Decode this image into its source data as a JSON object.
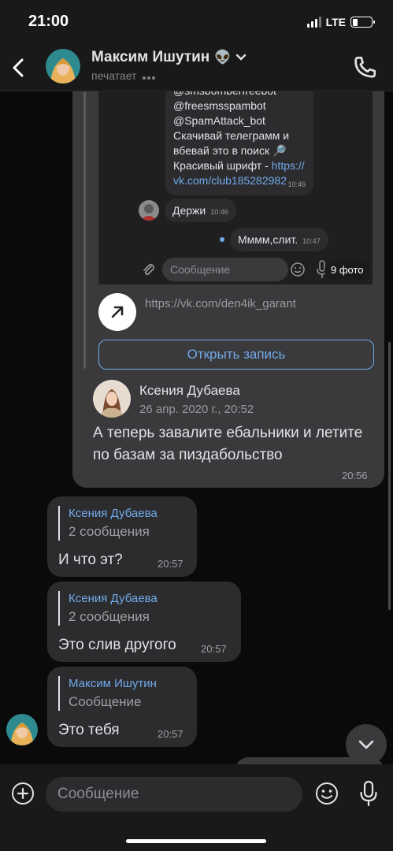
{
  "status_bar": {
    "time": "21:00",
    "network": "LTE",
    "battery_level": 0.3
  },
  "header": {
    "contact_name": "Максим Ишутин",
    "name_emoji": "👽",
    "status": "печатает",
    "icons": [
      "back-icon",
      "chevron-down-icon",
      "phone-icon"
    ]
  },
  "forwarded_post": {
    "screenshot": {
      "lines": [
        "@smsbomberfreebot",
        "@freesmsspambot",
        "@SpamAttack_bot",
        "Скачивай телеграмм и",
        "вбевай это в поиск 🔎",
        "Красивый шрифт - "
      ],
      "link_part1": "https://",
      "link_part2": "vk.com/club185282982",
      "first_time": "10:46",
      "reply1_text": "Держи",
      "reply1_time": "10:46",
      "reply2_text": "Мммм,слит.",
      "reply2_time": "10:47",
      "input_placeholder": "Сообщение",
      "photo_badge": "9 фото"
    },
    "link": {
      "url": "https://vk.com/den4ik_garant",
      "icon": "arrow-up-right-icon"
    },
    "open_button": "Открыть запись",
    "post": {
      "author": "Ксения Дубаева",
      "date": "26 апр. 2020 г., 20:52",
      "text": "А теперь завалите ебальники и летите по базам за пиздабольство"
    },
    "time": "20:56"
  },
  "messages": [
    {
      "reply_name": "Ксения Дубаева",
      "reply_text": "2 сообщения",
      "text": "И что эт?",
      "time": "20:57"
    },
    {
      "reply_name": "Ксения Дубаева",
      "reply_text": "2 сообщения",
      "text": "Это слив другого",
      "time": "20:57"
    },
    {
      "reply_name": "Максим Ишутин",
      "reply_text": "Сообщение",
      "text": "Это тебя",
      "time": "20:57"
    }
  ],
  "composer": {
    "placeholder": "Сообщение",
    "icons": [
      "plus-icon",
      "emoji-icon",
      "microphone-icon"
    ]
  },
  "colors": {
    "accent": "#71aaeb",
    "bubble": "#2c2c2e",
    "background": "#0a0a0a",
    "bar": "#191919"
  }
}
